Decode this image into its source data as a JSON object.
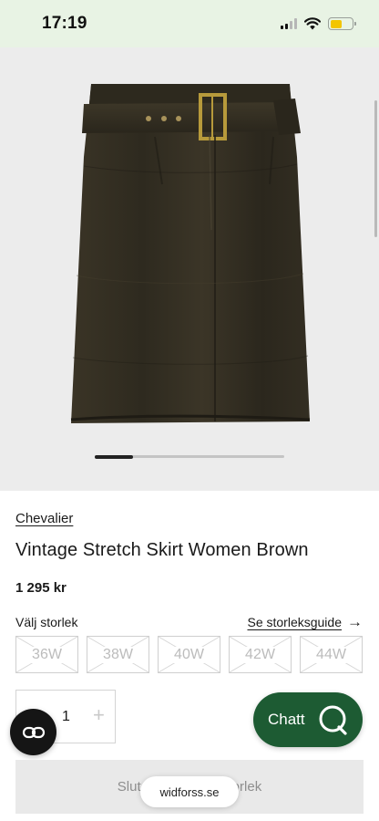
{
  "status_bar": {
    "time": "17:19",
    "icons": [
      "cellular-signal-icon",
      "wifi-icon",
      "battery-icon"
    ],
    "battery_color": "#f2c500"
  },
  "product_image": {
    "alt": "Vintage Stretch Skirt Women Brown",
    "carousel_position": 1
  },
  "product": {
    "brand": "Chevalier",
    "title": "Vintage Stretch Skirt Women Brown",
    "price": "1 295 kr"
  },
  "sizes": {
    "label": "Välj storlek",
    "guide_link": "Se storleksguide",
    "options": [
      "36W",
      "38W",
      "40W",
      "42W",
      "44W"
    ],
    "all_unavailable": true
  },
  "quantity": {
    "value": "1",
    "plus": "+"
  },
  "chat": {
    "label": "Chatt",
    "color": "#1d5b33"
  },
  "cta": {
    "label": "Slut i lager i vald storlek"
  },
  "browser": {
    "domain": "widforss.se"
  }
}
